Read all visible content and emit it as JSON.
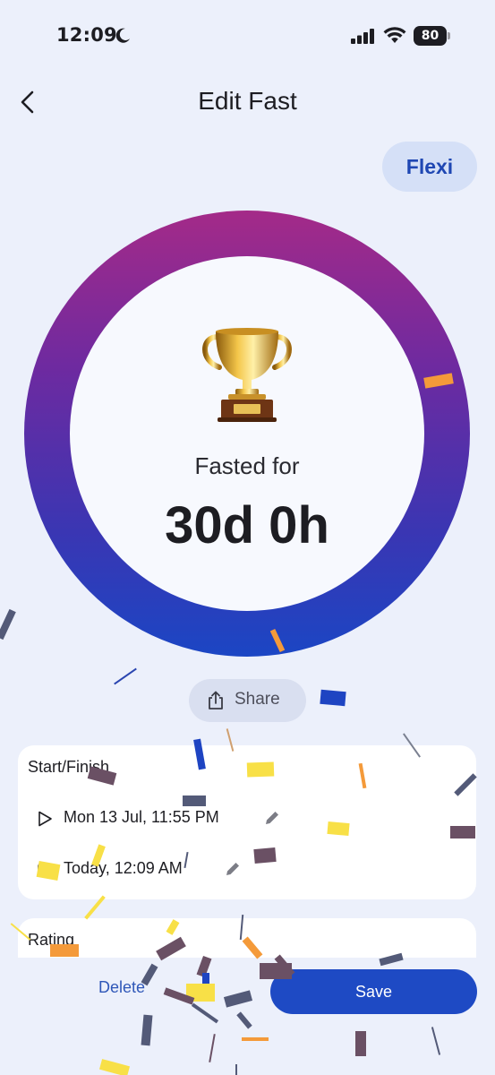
{
  "status_bar": {
    "time": "12:09",
    "battery": "80"
  },
  "header": {
    "title": "Edit Fast",
    "back_icon": "chevron-left-icon"
  },
  "plan_badge": "Flexi",
  "progress_ring": {
    "progress": 1.0,
    "icon": "trophy-icon",
    "label": "Fasted for",
    "value": "30d 0h",
    "gradient_colors": [
      "#a42a88",
      "#6e2aa0",
      "#3a36b3",
      "#1b46c4"
    ]
  },
  "share": {
    "label": "Share",
    "icon": "share-icon"
  },
  "start_finish": {
    "title": "Start/Finish",
    "start": "Mon 13 Jul, 11:55 PM",
    "end": "Today, 12:09 AM"
  },
  "rating": {
    "title": "Rating"
  },
  "actions": {
    "delete_label": "Delete",
    "save_label": "Save"
  },
  "colors": {
    "background": "#ecf0fb",
    "accent": "#1e4ac4",
    "badge_bg": "#d5e0f7"
  }
}
